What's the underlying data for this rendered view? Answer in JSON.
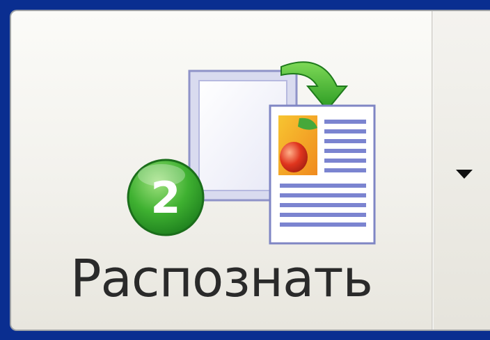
{
  "toolbar": {
    "recognize_button": {
      "label": "Распознать",
      "step_number": "2",
      "icon": "recognize-document-icon"
    },
    "dropdown": {
      "icon": "triangle-down-icon"
    }
  },
  "colors": {
    "frame_background": "#0a2e90",
    "button_face": "#f2f1ec",
    "badge_green": "#2fa52a",
    "arrow_green": "#3fb432",
    "label_text": "#2a2a2a"
  }
}
